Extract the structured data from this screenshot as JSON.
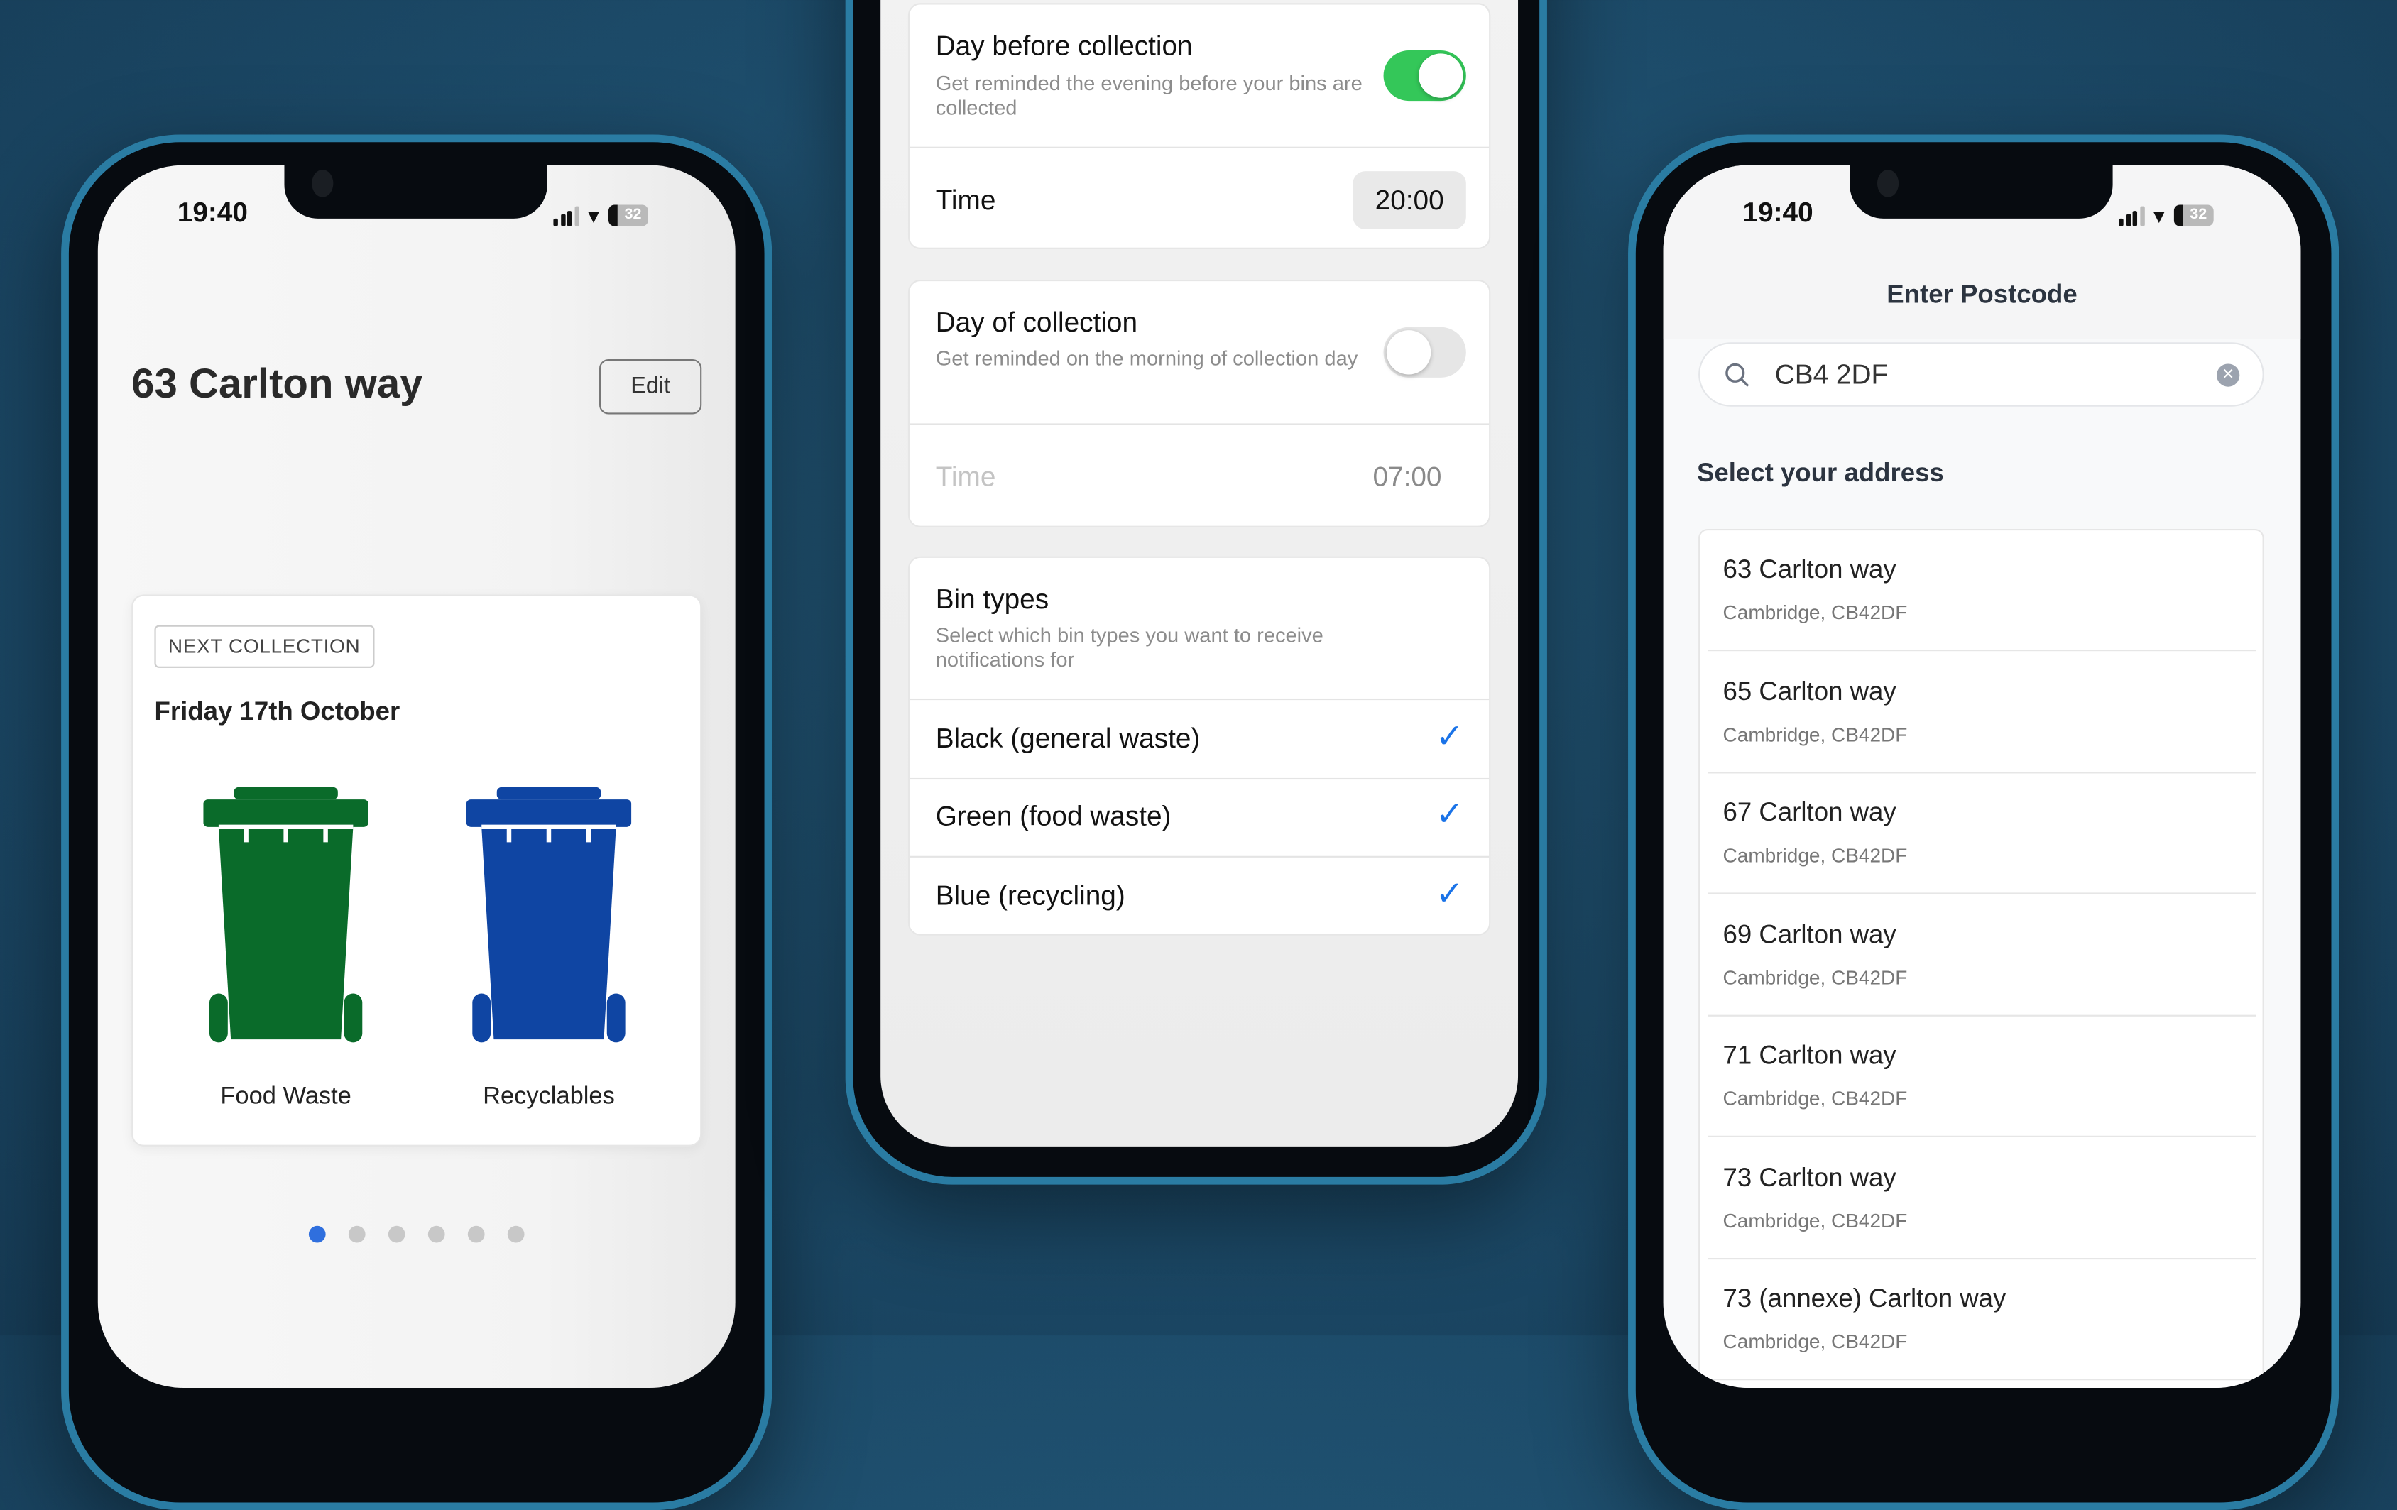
{
  "status_bar": {
    "time": "19:40",
    "battery": "32"
  },
  "home": {
    "address_title": "63 Carlton way",
    "edit_label": "Edit",
    "badge": "NEXT COLLECTION",
    "date": "Friday 17th October",
    "bins": [
      {
        "label": "Food Waste",
        "color": "#0a6b2a"
      },
      {
        "label": "Recyclables",
        "color": "#0f45a3"
      }
    ],
    "pager": {
      "count": 6,
      "active": 0,
      "active_color": "#2f6fde"
    }
  },
  "settings": {
    "day_before": {
      "title": "Day before collection",
      "subtitle": "Get reminded the evening before your bins are collected",
      "enabled": true,
      "time_label": "Time",
      "time": "20:00"
    },
    "day_of": {
      "title": "Day of collection",
      "subtitle": "Get reminded on the morning of collection day",
      "enabled": false,
      "time_label": "Time",
      "time": "07:00"
    },
    "bin_types": {
      "title": "Bin types",
      "subtitle": "Select which bin types you want to receive notifications for",
      "items": [
        {
          "label": "Black (general waste)",
          "checked": true
        },
        {
          "label": "Green (food waste)",
          "checked": true
        },
        {
          "label": "Blue (recycling)",
          "checked": true
        }
      ]
    },
    "accent": "#34c759"
  },
  "postcode": {
    "title": "Enter Postcode",
    "search_value": "CB4 2DF",
    "section_label": "Select your address",
    "addresses": [
      {
        "line1": "63 Carlton way",
        "line2": "Cambridge, CB42DF"
      },
      {
        "line1": "65 Carlton way",
        "line2": "Cambridge, CB42DF"
      },
      {
        "line1": "67 Carlton way",
        "line2": "Cambridge, CB42DF"
      },
      {
        "line1": "69 Carlton way",
        "line2": "Cambridge, CB42DF"
      },
      {
        "line1": "71 Carlton way",
        "line2": "Cambridge, CB42DF"
      },
      {
        "line1": "73 Carlton way",
        "line2": "Cambridge, CB42DF"
      },
      {
        "line1": "73 (annexe) Carlton way",
        "line2": "Cambridge, CB42DF"
      }
    ]
  }
}
